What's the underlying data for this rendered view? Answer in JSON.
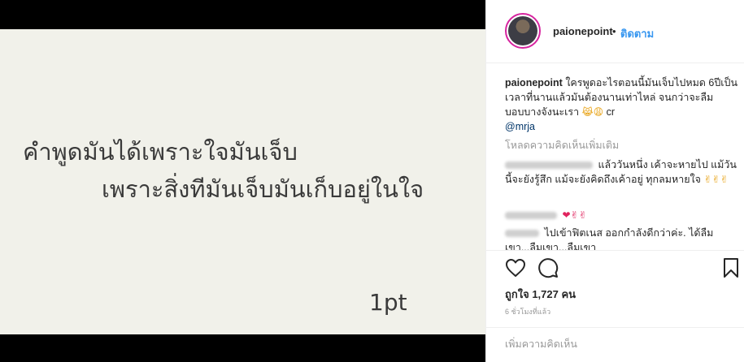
{
  "media": {
    "line1": "คำพูดมันได้เพราะใจมันเจ็บ",
    "line2": "เพราะสิ่งทีมันเจ็บมันเก็บอยู่ในใจ",
    "signature": "1pt"
  },
  "header": {
    "username": "paionepoint",
    "separator": "•",
    "follow_label": "ติดตาม"
  },
  "caption": {
    "username": "paionepoint",
    "text": "ใครพูดอะไรตอนนี้มันเจ็บไปหมด 6ปีเป็นเวลาที่นานแล้วมันต้องนานเท่าไหล่ จนกว่าจะลืม บอบบางจังนะเรา",
    "emoji": "😹😩",
    "credit": "cr",
    "mention": "@mrja"
  },
  "load_more_label": "โหลดความคิดเห็นเพิ่มเติม",
  "comments": [
    {
      "text": "แล้ววันหนึ่ง เค้าจะหายไป แม้วันนี้จะยังรู้สึก แม้จะยังคิดถึงเค้าอยู่ ทุกลมหายใจ",
      "emoji": "✌✌✌"
    },
    {
      "text": "",
      "emoji": "❤✌✌"
    },
    {
      "text": "ไปเข้าฟิตเนส ออกกำลังดีกว่าค่ะ. ได้ลืมเขา...ลืมเขา...ลืมเขา"
    }
  ],
  "likes_label": "ถูกใจ 1,727 คน",
  "time_ago": "6 ชั่วโมงที่แล้ว",
  "add_comment_placeholder": "เพิ่มความคิดเห็น"
}
